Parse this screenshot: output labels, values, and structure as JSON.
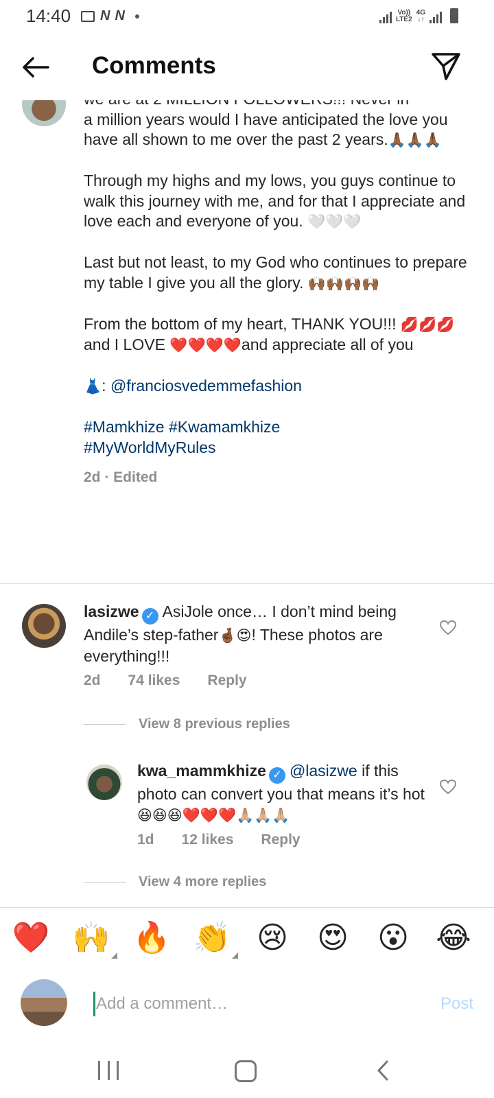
{
  "status_bar": {
    "time": "14:40",
    "left_icons": [
      "image-icon",
      "n-icon",
      "n-icon",
      "dot-icon"
    ],
    "lte_top": "Vo))",
    "lte_bottom": "LTE2",
    "net": "4G"
  },
  "header": {
    "title": "Comments"
  },
  "caption": {
    "top_partial": "we are at 2 MILLION FOLLOWERS!!! Never in",
    "p1": "a million years would I have anticipated the love you have all shown to me over the past 2 years.",
    "p1_emoji": "🙏🏾🙏🏾🙏🏾",
    "p2": "Through my highs and my lows, you guys continue to walk this journey with me, and for that I appreciate and love each and everyone of you.",
    "p2_emoji": "🤍🤍🤍",
    "p3": "Last but not least, to my God who continues to prepare my table I give you all the glory.",
    "p3_emoji": "🙌🏾🙌🏾🙌🏾🙌🏾",
    "p4_a": "From the bottom of my heart, THANK YOU!!!",
    "p4_kiss": "💋💋💋",
    "p4_b": "and I LOVE",
    "p4_hearts": "❤️❤️❤️❤️",
    "p4_c": "and appreciate all of you",
    "dress_emoji": "👗",
    "dress_sep": ": ",
    "mention": "@franciosvedemmefashion",
    "hashtag1": "#Mamkhize",
    "hashtag2": "#Kwamamkhize",
    "hashtag3": "#MyWorldMyRules",
    "meta": "2d · Edited"
  },
  "comments": [
    {
      "username": "lasizwe",
      "verified": true,
      "text_a": "AsiJole once… I don’t mind being Andile’s step-father",
      "emoji": "🤞🏾😍",
      "text_b": "! These photos are everything!!!",
      "time": "2d",
      "likes": "74 likes",
      "reply": "Reply"
    }
  ],
  "view_previous": "View 8 previous replies",
  "reply": {
    "username": "kwa_mammkhize",
    "verified": true,
    "mention": "@lasizwe",
    "text": " if this photo can convert you that means it’s hot",
    "emoji": "😆😆😆❤️❤️❤️🙏🏼🙏🏼🙏🏼",
    "time": "1d",
    "likes": "12 likes",
    "reply": "Reply"
  },
  "view_more": "View 4 more replies",
  "reactions": [
    "❤️",
    "🙌",
    "🔥",
    "👏",
    "😢",
    "😍",
    "😮",
    "😂"
  ],
  "input": {
    "placeholder": "Add a comment…",
    "post": "Post"
  },
  "colors": {
    "link": "#00376b",
    "muted": "#8e8e8e",
    "verified": "#3897f0",
    "post_disabled": "#b3dbff"
  }
}
